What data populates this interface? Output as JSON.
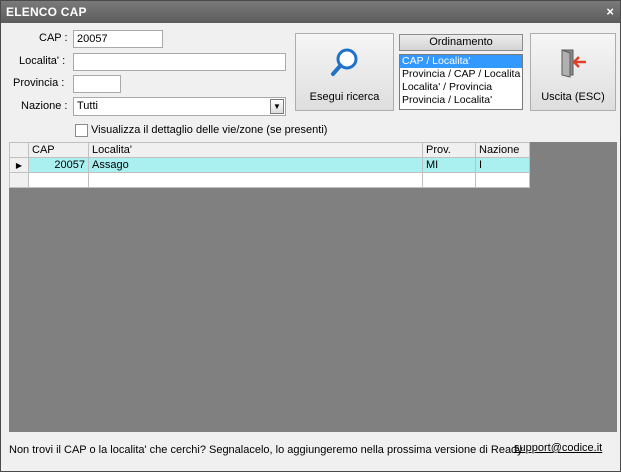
{
  "window": {
    "title": "ELENCO CAP",
    "close_label": "×"
  },
  "form": {
    "cap_label": "CAP :",
    "cap_value": "20057",
    "localita_label": "Localita' :",
    "localita_value": "",
    "provincia_label": "Provincia :",
    "provincia_value": "",
    "nazione_label": "Nazione :",
    "nazione_value": "Tutti",
    "detail_checkbox_label": "Visualizza il dettaglio delle vie/zone (se presenti)",
    "detail_checked": false
  },
  "buttons": {
    "search_label": "Esegui ricerca",
    "exit_label": "Uscita (ESC)"
  },
  "ordering": {
    "header": "Ordinamento",
    "options": [
      "CAP / Localita'",
      "Provincia / CAP / Localita",
      "Localita' / Provincia",
      "Provincia / Localita'"
    ],
    "selected_index": 0
  },
  "grid": {
    "columns": [
      "CAP",
      "Localita'",
      "Prov.",
      "Nazione"
    ],
    "rows": [
      {
        "cap": "20057",
        "localita": "Assago",
        "prov": "MI",
        "nazione": "I",
        "current": true
      }
    ]
  },
  "footer": {
    "message": "Non trovi il CAP o la localita' che cerchi? Segnalacelo, lo aggiungeremo nella prossima versione di Ready",
    "support_link": "support@codice.it"
  },
  "colors": {
    "title_bar": "#666666",
    "selected_row": "#aaf0f0",
    "selection_blue": "#3399ff",
    "grid_background": "#808080"
  }
}
